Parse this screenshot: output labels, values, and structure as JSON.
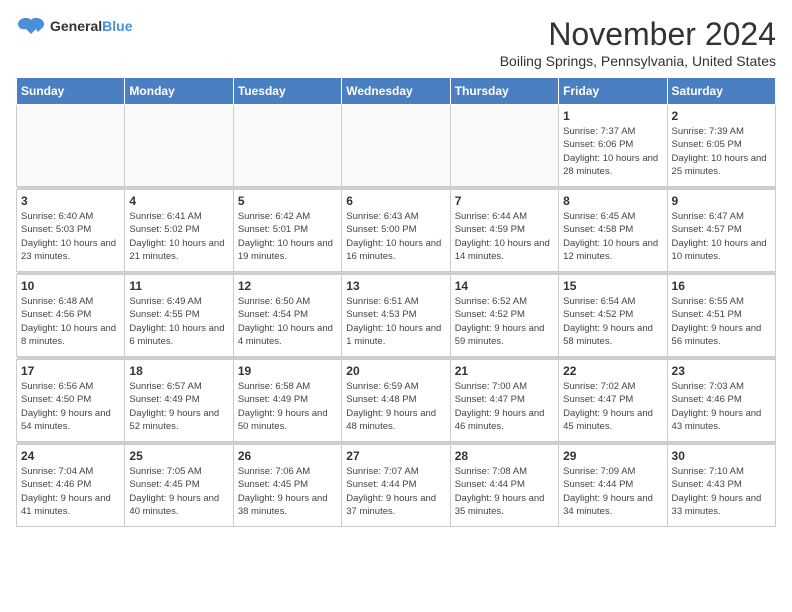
{
  "header": {
    "logo_general": "General",
    "logo_blue": "Blue",
    "month_title": "November 2024",
    "subtitle": "Boiling Springs, Pennsylvania, United States"
  },
  "days_of_week": [
    "Sunday",
    "Monday",
    "Tuesday",
    "Wednesday",
    "Thursday",
    "Friday",
    "Saturday"
  ],
  "weeks": [
    [
      {
        "day": "",
        "info": ""
      },
      {
        "day": "",
        "info": ""
      },
      {
        "day": "",
        "info": ""
      },
      {
        "day": "",
        "info": ""
      },
      {
        "day": "",
        "info": ""
      },
      {
        "day": "1",
        "info": "Sunrise: 7:37 AM\nSunset: 6:06 PM\nDaylight: 10 hours and 28 minutes."
      },
      {
        "day": "2",
        "info": "Sunrise: 7:39 AM\nSunset: 6:05 PM\nDaylight: 10 hours and 25 minutes."
      }
    ],
    [
      {
        "day": "3",
        "info": "Sunrise: 6:40 AM\nSunset: 5:03 PM\nDaylight: 10 hours and 23 minutes."
      },
      {
        "day": "4",
        "info": "Sunrise: 6:41 AM\nSunset: 5:02 PM\nDaylight: 10 hours and 21 minutes."
      },
      {
        "day": "5",
        "info": "Sunrise: 6:42 AM\nSunset: 5:01 PM\nDaylight: 10 hours and 19 minutes."
      },
      {
        "day": "6",
        "info": "Sunrise: 6:43 AM\nSunset: 5:00 PM\nDaylight: 10 hours and 16 minutes."
      },
      {
        "day": "7",
        "info": "Sunrise: 6:44 AM\nSunset: 4:59 PM\nDaylight: 10 hours and 14 minutes."
      },
      {
        "day": "8",
        "info": "Sunrise: 6:45 AM\nSunset: 4:58 PM\nDaylight: 10 hours and 12 minutes."
      },
      {
        "day": "9",
        "info": "Sunrise: 6:47 AM\nSunset: 4:57 PM\nDaylight: 10 hours and 10 minutes."
      }
    ],
    [
      {
        "day": "10",
        "info": "Sunrise: 6:48 AM\nSunset: 4:56 PM\nDaylight: 10 hours and 8 minutes."
      },
      {
        "day": "11",
        "info": "Sunrise: 6:49 AM\nSunset: 4:55 PM\nDaylight: 10 hours and 6 minutes."
      },
      {
        "day": "12",
        "info": "Sunrise: 6:50 AM\nSunset: 4:54 PM\nDaylight: 10 hours and 4 minutes."
      },
      {
        "day": "13",
        "info": "Sunrise: 6:51 AM\nSunset: 4:53 PM\nDaylight: 10 hours and 1 minute."
      },
      {
        "day": "14",
        "info": "Sunrise: 6:52 AM\nSunset: 4:52 PM\nDaylight: 9 hours and 59 minutes."
      },
      {
        "day": "15",
        "info": "Sunrise: 6:54 AM\nSunset: 4:52 PM\nDaylight: 9 hours and 58 minutes."
      },
      {
        "day": "16",
        "info": "Sunrise: 6:55 AM\nSunset: 4:51 PM\nDaylight: 9 hours and 56 minutes."
      }
    ],
    [
      {
        "day": "17",
        "info": "Sunrise: 6:56 AM\nSunset: 4:50 PM\nDaylight: 9 hours and 54 minutes."
      },
      {
        "day": "18",
        "info": "Sunrise: 6:57 AM\nSunset: 4:49 PM\nDaylight: 9 hours and 52 minutes."
      },
      {
        "day": "19",
        "info": "Sunrise: 6:58 AM\nSunset: 4:49 PM\nDaylight: 9 hours and 50 minutes."
      },
      {
        "day": "20",
        "info": "Sunrise: 6:59 AM\nSunset: 4:48 PM\nDaylight: 9 hours and 48 minutes."
      },
      {
        "day": "21",
        "info": "Sunrise: 7:00 AM\nSunset: 4:47 PM\nDaylight: 9 hours and 46 minutes."
      },
      {
        "day": "22",
        "info": "Sunrise: 7:02 AM\nSunset: 4:47 PM\nDaylight: 9 hours and 45 minutes."
      },
      {
        "day": "23",
        "info": "Sunrise: 7:03 AM\nSunset: 4:46 PM\nDaylight: 9 hours and 43 minutes."
      }
    ],
    [
      {
        "day": "24",
        "info": "Sunrise: 7:04 AM\nSunset: 4:46 PM\nDaylight: 9 hours and 41 minutes."
      },
      {
        "day": "25",
        "info": "Sunrise: 7:05 AM\nSunset: 4:45 PM\nDaylight: 9 hours and 40 minutes."
      },
      {
        "day": "26",
        "info": "Sunrise: 7:06 AM\nSunset: 4:45 PM\nDaylight: 9 hours and 38 minutes."
      },
      {
        "day": "27",
        "info": "Sunrise: 7:07 AM\nSunset: 4:44 PM\nDaylight: 9 hours and 37 minutes."
      },
      {
        "day": "28",
        "info": "Sunrise: 7:08 AM\nSunset: 4:44 PM\nDaylight: 9 hours and 35 minutes."
      },
      {
        "day": "29",
        "info": "Sunrise: 7:09 AM\nSunset: 4:44 PM\nDaylight: 9 hours and 34 minutes."
      },
      {
        "day": "30",
        "info": "Sunrise: 7:10 AM\nSunset: 4:43 PM\nDaylight: 9 hours and 33 minutes."
      }
    ]
  ]
}
